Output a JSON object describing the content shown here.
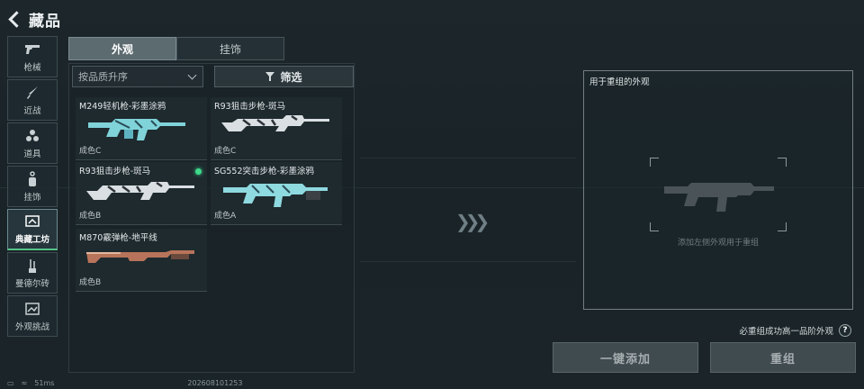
{
  "header": {
    "title": "藏品"
  },
  "sidebar": {
    "items": [
      {
        "label": "枪械",
        "icon": "pistol-icon"
      },
      {
        "label": "近战",
        "icon": "knife-icon"
      },
      {
        "label": "道具",
        "icon": "grenade-icon"
      },
      {
        "label": "挂饰",
        "icon": "charm-icon"
      },
      {
        "label": "典藏工坊",
        "icon": "workshop-icon",
        "active": true
      },
      {
        "label": "曼德尔砖",
        "icon": "clip-icon"
      },
      {
        "label": "外观挑战",
        "icon": "challenge-icon"
      }
    ]
  },
  "tabs": [
    {
      "label": "外观",
      "active": true
    },
    {
      "label": "挂饰",
      "active": false
    }
  ],
  "sort": {
    "value": "按品质升序"
  },
  "filter": {
    "label": "筛选"
  },
  "items": [
    {
      "name": "M249轻机枪-彩墨涂鸦",
      "grade": "成色C",
      "selected": false
    },
    {
      "name": "R93狙击步枪-斑马",
      "grade": "成色C",
      "selected": false
    },
    {
      "name": "R93狙击步枪-斑马",
      "grade": "成色B",
      "selected": true
    },
    {
      "name": "SG552突击步枪-彩墨涂鸦",
      "grade": "成色A",
      "selected": false
    },
    {
      "name": "M870霰弹枪-地平线",
      "grade": "成色B",
      "selected": false
    }
  ],
  "reassemble": {
    "title": "用于重组的外观",
    "hint": "添加左侧外观用于重组",
    "help_text": "必重组成功高一品阶外观",
    "help_icon": "?",
    "add_all_label": "一键添加",
    "reassemble_label": "重组"
  },
  "status": {
    "ping": "51ms",
    "build": "202608101253"
  },
  "colors": {
    "accent_green": "#3ed98a",
    "active_tab": "#5c6b70"
  }
}
